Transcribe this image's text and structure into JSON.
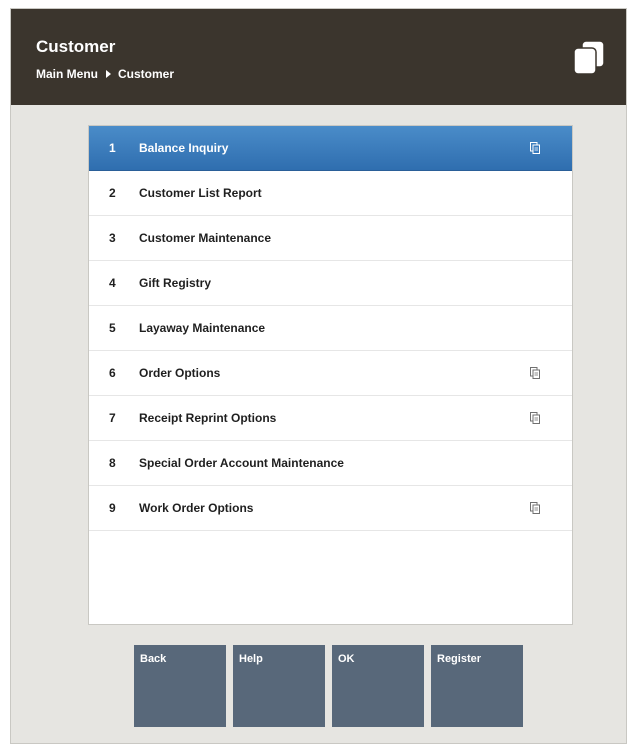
{
  "header": {
    "title": "Customer",
    "breadcrumb": {
      "parent": "Main Menu",
      "current": "Customer"
    }
  },
  "menu": {
    "items": [
      {
        "number": "1",
        "label": "Balance Inquiry",
        "has_submenu_icon": true,
        "selected": true
      },
      {
        "number": "2",
        "label": "Customer List Report",
        "has_submenu_icon": false
      },
      {
        "number": "3",
        "label": "Customer Maintenance",
        "has_submenu_icon": false
      },
      {
        "number": "4",
        "label": "Gift Registry",
        "has_submenu_icon": false
      },
      {
        "number": "5",
        "label": "Layaway Maintenance",
        "has_submenu_icon": false
      },
      {
        "number": "6",
        "label": "Order Options",
        "has_submenu_icon": true
      },
      {
        "number": "7",
        "label": "Receipt Reprint Options",
        "has_submenu_icon": true
      },
      {
        "number": "8",
        "label": "Special Order Account Maintenance",
        "has_submenu_icon": false
      },
      {
        "number": "9",
        "label": "Work Order Options",
        "has_submenu_icon": true
      }
    ]
  },
  "buttons": {
    "back": "Back",
    "help": "Help",
    "ok": "OK",
    "register": "Register"
  },
  "colors": {
    "header_bg": "#3b352d",
    "selected_bg": "#3a7bbd",
    "button_bg": "#58687a",
    "page_bg": "#e6e5e1"
  },
  "icons": {
    "app": "windows-stack-icon",
    "submenu": "submenu-icon"
  }
}
